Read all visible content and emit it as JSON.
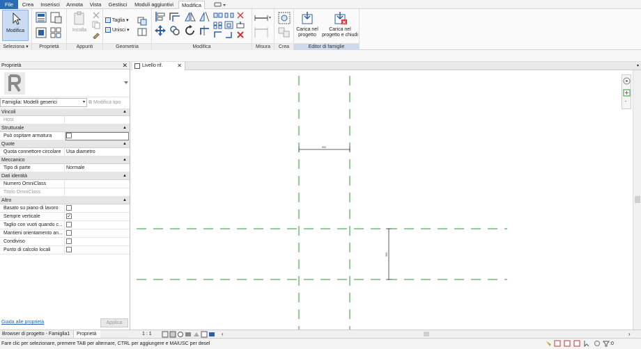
{
  "menu_tabs": [
    "File",
    "Crea",
    "Inserisci",
    "Annota",
    "Vista",
    "Gestisci",
    "Moduli aggiuntivi",
    "Modifica"
  ],
  "ribbon": {
    "modifica_label": "Modifica",
    "seleziona": "Seleziona",
    "proprieta": "Proprietà",
    "appunti": "Appunti",
    "incolla": "Incolla",
    "geometria": "Geometria",
    "taglia": "Taglia",
    "unisci": "Unisci",
    "modifica_panel": "Modifica",
    "misura": "Misura",
    "crea": "Crea",
    "editor": "Editor di famiglie",
    "carica_progetto": "Carica nel progetto",
    "carica_chiudi": "Carica nel progetto e chiudi"
  },
  "properties": {
    "title": "Proprietà",
    "type_selector": "Famiglia: Modelli generici",
    "edit_type": "Modifica tipo",
    "groups": {
      "vincoli": "Vincoli",
      "strutturale": "Strutturale",
      "quote": "Quote",
      "meccanico": "Meccanico",
      "dati": "Dati identità",
      "altro": "Altro"
    },
    "rows": {
      "host": "Host",
      "armatura": "Può ospitare armatura",
      "quota_conn": "Quota connettore circolare",
      "quota_val": "Usa diametro",
      "tipo_parte": "Tipo di parte",
      "tipo_val": "Normale",
      "numero": "Numero OmniClass",
      "titolo": "Titolo OmniClass",
      "basato": "Basato su piano di lavoro",
      "sempre": "Sempre verticale",
      "taglio": "Taglio con vuoti quando c...",
      "mantieni": "Mantieni orientamento an...",
      "condiviso": "Condiviso",
      "punto": "Punto di calcolo locali"
    },
    "help_link": "Guida alle proprietà",
    "apply": "Applica"
  },
  "view_tab": "Livello rif.",
  "scale": "1 : 1",
  "dimension_value_h": "500",
  "dimension_value_v": "500",
  "bottom_tabs": [
    "Browser di progetto - Famiglia1",
    "Proprietà"
  ],
  "status_text": "Fare clic per selezionare, premere TAB per alternare, CTRL per aggiungere e MAIUSC per desel",
  "status_filter_count": ":0",
  "colors": {
    "file_tab": "#2b6cb8",
    "ref_plane": "#2e9a2e",
    "editor_panel": "#cfd9ec"
  }
}
